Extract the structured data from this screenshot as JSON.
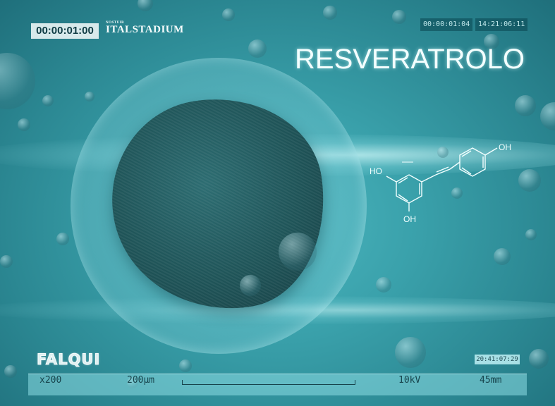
{
  "overlay": {
    "timecode": "00:00:01:00",
    "brand_small": "NOSTUIB",
    "brand_main": "ITALSTADIUM",
    "tc_top_left": "00:00:01:04",
    "tc_top_right": "14:21:06:11",
    "title": "RESVERATROLO",
    "logo": "FALQUI",
    "tc_bottom": "20:41:07:29"
  },
  "molecule": {
    "label_ho": "HO",
    "label_oh_top": "OH",
    "label_oh_bottom": "OH"
  },
  "scale_bar": {
    "magnification": "x200",
    "length": "200µm",
    "voltage": "10kV",
    "distance": "45mm"
  }
}
